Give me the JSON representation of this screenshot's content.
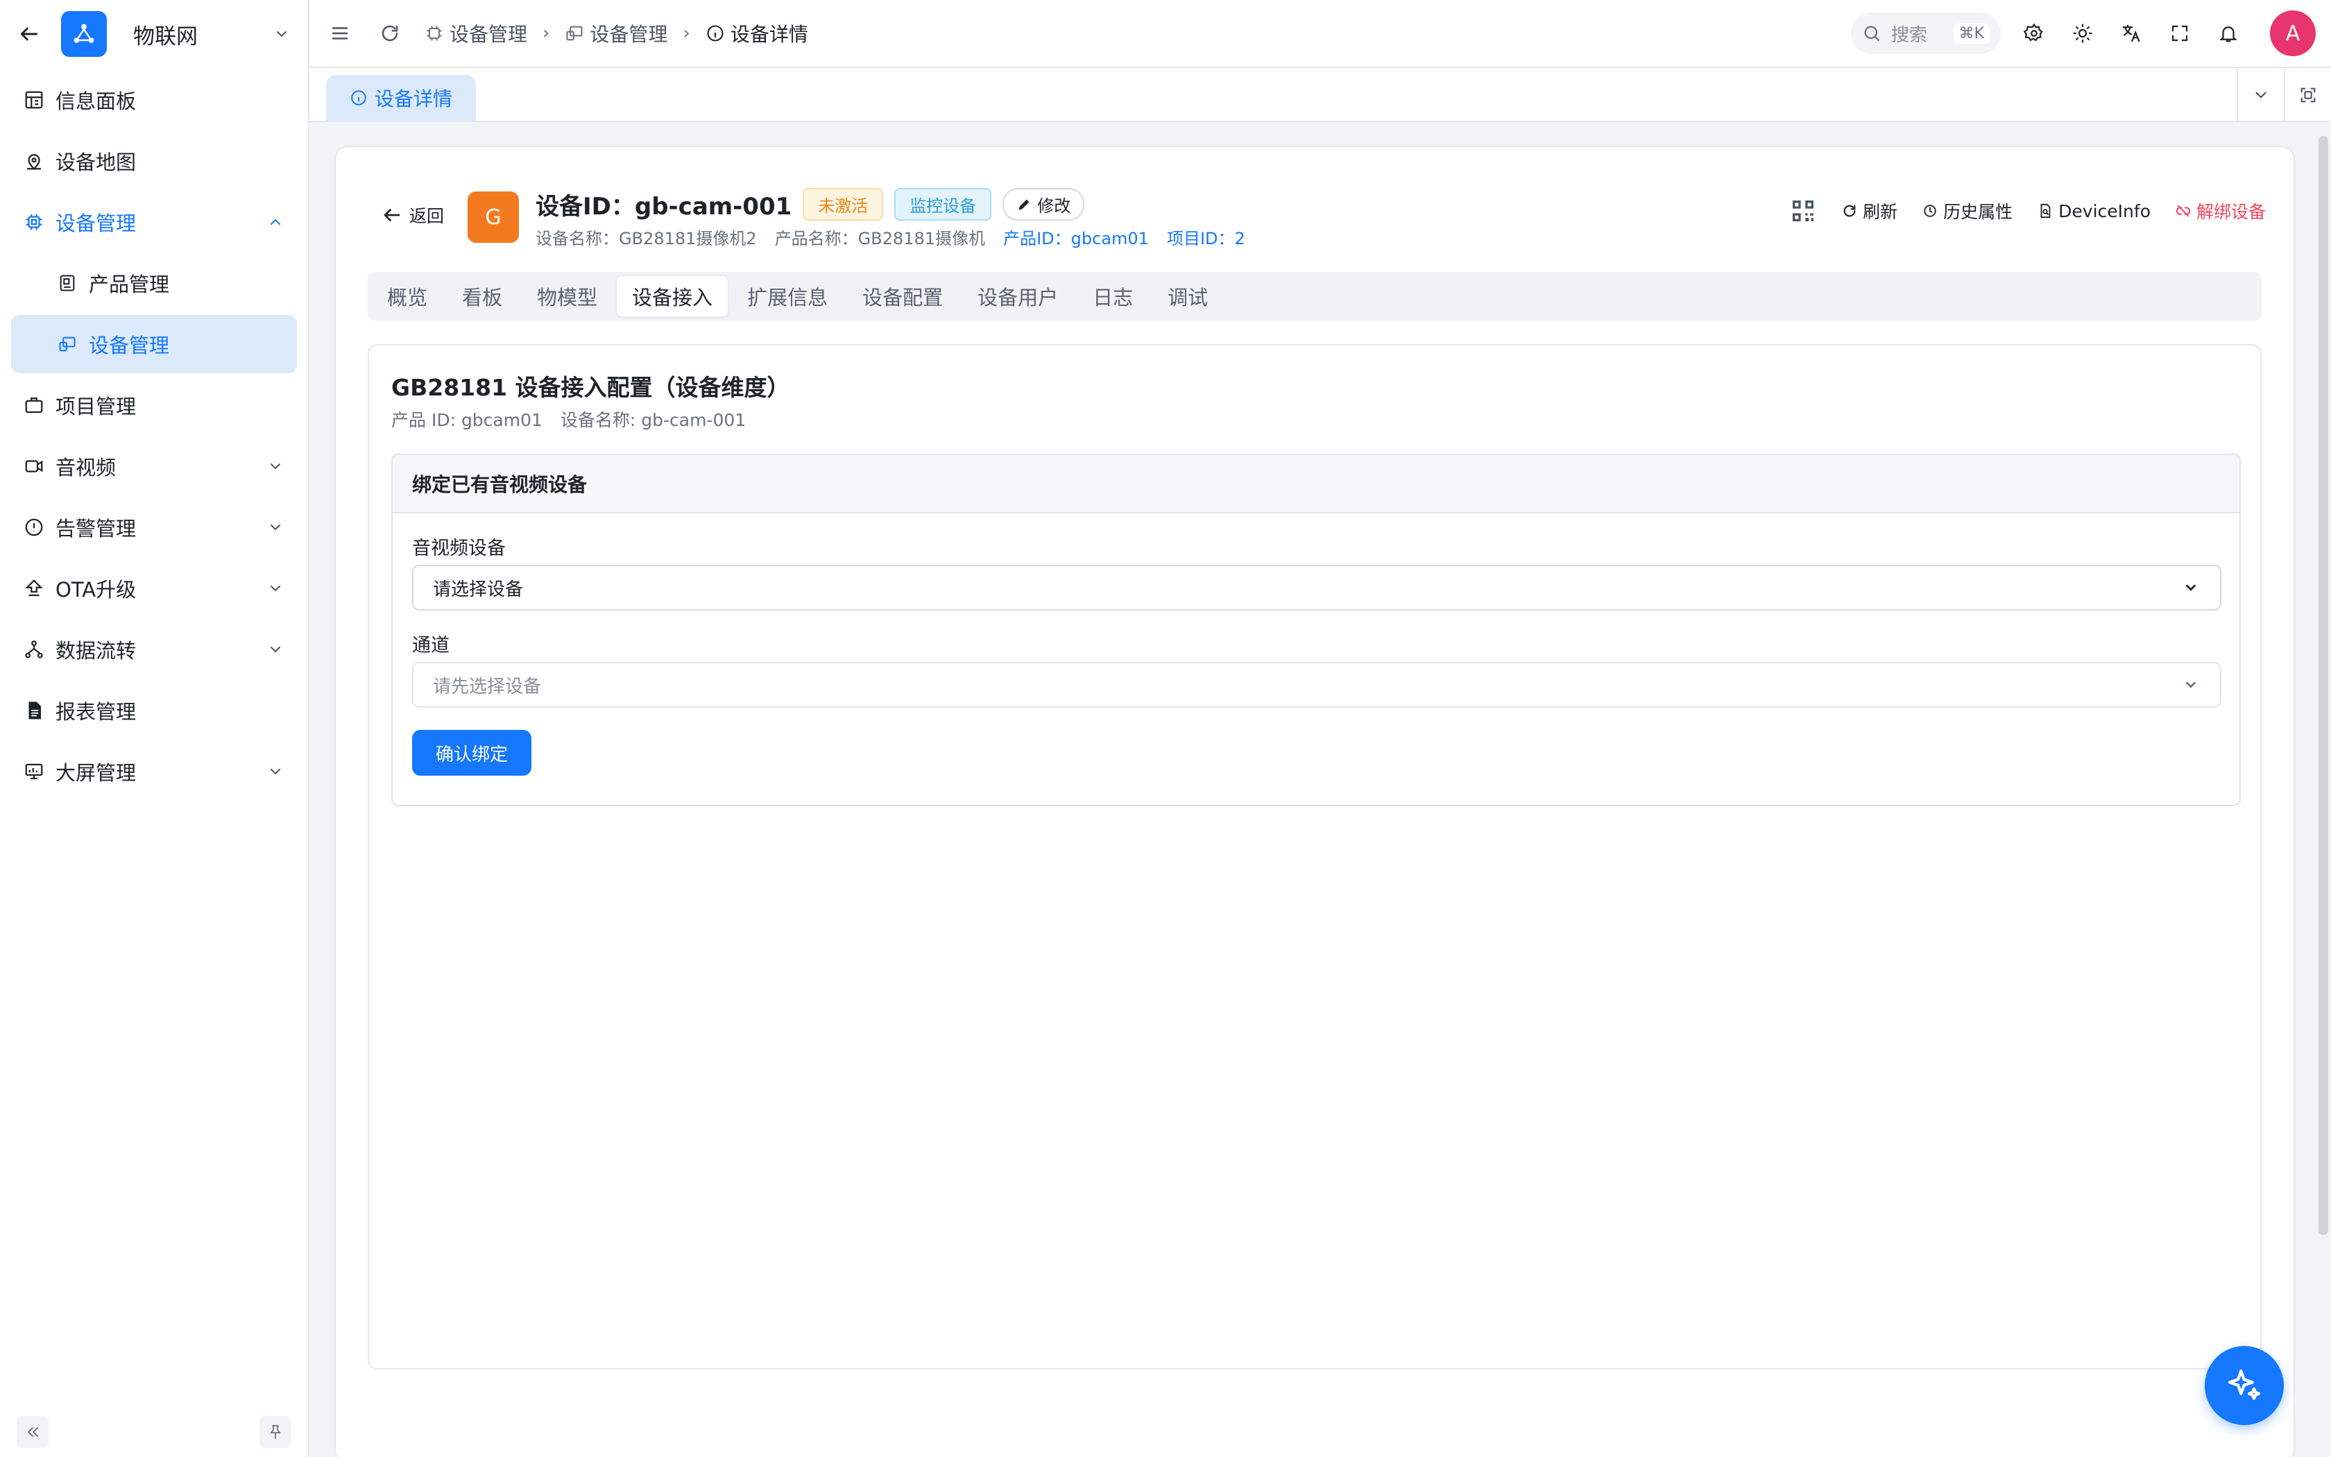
{
  "app": {
    "title": "物联网"
  },
  "sidebar": {
    "items": [
      {
        "label": "信息面板"
      },
      {
        "label": "设备地图"
      },
      {
        "label": "设备管理"
      },
      {
        "label": "产品管理"
      },
      {
        "label": "设备管理"
      },
      {
        "label": "项目管理"
      },
      {
        "label": "音视频"
      },
      {
        "label": "告警管理"
      },
      {
        "label": "OTA升级"
      },
      {
        "label": "数据流转"
      },
      {
        "label": "报表管理"
      },
      {
        "label": "大屏管理"
      }
    ]
  },
  "header": {
    "breadcrumbs": [
      "设备管理",
      "设备管理",
      "设备详情"
    ],
    "search_placeholder": "搜索",
    "search_shortcut": "⌘K",
    "avatar_initial": "A"
  },
  "page_tab": {
    "label": "设备详情"
  },
  "device": {
    "back_label": "返回",
    "avatar_letter": "G",
    "title": "设备ID：gb-cam-001",
    "status_tag": "未激活",
    "type_tag": "监控设备",
    "edit_label": "修改",
    "device_name": "设备名称：GB28181摄像机2",
    "product_name": "产品名称：GB28181摄像机",
    "product_id": "产品ID：gbcam01",
    "project_id": "项目ID：2",
    "actions": {
      "refresh": "刷新",
      "history": "历史属性",
      "deviceinfo": "DeviceInfo",
      "unbind": "解绑设备"
    }
  },
  "tabs": [
    "概览",
    "看板",
    "物模型",
    "设备接入",
    "扩展信息",
    "设备配置",
    "设备用户",
    "日志",
    "调试"
  ],
  "active_tab": "设备接入",
  "panel": {
    "title": "GB28181 设备接入配置（设备维度）",
    "product_id": "产品 ID: gbcam01",
    "device_name": "设备名称: gb-cam-001",
    "bind_title": "绑定已有音视频设备",
    "av_device_label": "音视频设备",
    "av_device_value": "请选择设备",
    "channel_label": "通道",
    "channel_value": "请先选择设备",
    "confirm_label": "确认绑定"
  },
  "colors": {
    "accent": "#1677ff",
    "danger": "#f5455c",
    "logo": "#1677ff",
    "device_avatar": "#f47a20",
    "user_avatar": "#e8356e"
  }
}
